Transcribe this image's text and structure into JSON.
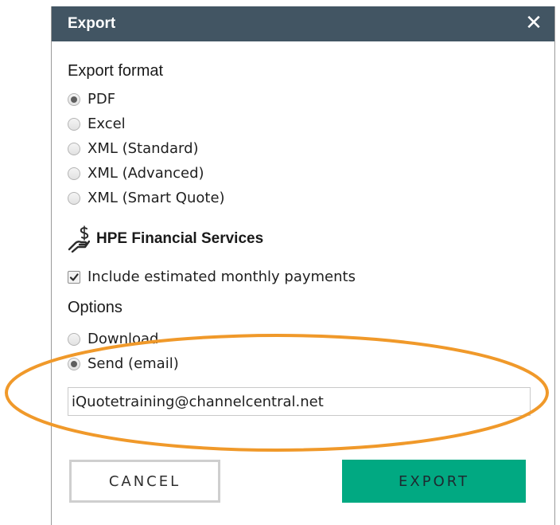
{
  "dialog": {
    "title": "Export",
    "close_glyph": "✕"
  },
  "export_format": {
    "heading": "Export format",
    "options": [
      {
        "label": "PDF",
        "checked": true
      },
      {
        "label": "Excel",
        "checked": false
      },
      {
        "label": "XML (Standard)",
        "checked": false
      },
      {
        "label": "XML (Advanced)",
        "checked": false
      },
      {
        "label": "XML (Smart Quote)",
        "checked": false
      }
    ]
  },
  "financial": {
    "label": "HPE Financial Services",
    "icon": "hand-money-icon",
    "include_payments": {
      "label": "Include estimated monthly payments",
      "checked": true
    }
  },
  "options": {
    "heading": "Options",
    "choices": [
      {
        "label": "Download",
        "checked": false
      },
      {
        "label": "Send (email)",
        "checked": true
      }
    ],
    "email": {
      "value": "iQuotetraining@channelcentral.net",
      "placeholder": ""
    }
  },
  "buttons": {
    "cancel": "CANCEL",
    "export": "EXPORT"
  },
  "colors": {
    "title_bar": "#425563",
    "export_button": "#01a982",
    "highlight_ellipse": "#f0992a"
  }
}
